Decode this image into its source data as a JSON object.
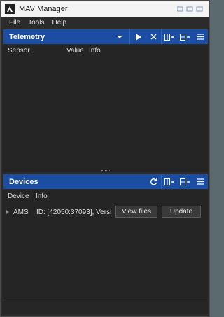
{
  "window": {
    "title": "MAV Manager"
  },
  "menu": {
    "items": [
      "File",
      "Tools",
      "Help"
    ]
  },
  "telemetry": {
    "title": "Telemetry",
    "columns": [
      "Sensor",
      "Value",
      "Info"
    ]
  },
  "devices": {
    "title": "Devices",
    "columns": [
      "Device",
      "Info"
    ],
    "rows": [
      {
        "device": "AMS",
        "info": "ID: [42050:37093], Versi",
        "view_label": "View files",
        "update_label": "Update"
      }
    ]
  },
  "icons": {
    "play": "play-icon",
    "close": "close-icon",
    "add_column": "add-column-icon",
    "add_row": "add-row-icon",
    "menu": "hamburger-menu-icon",
    "refresh": "refresh-icon"
  },
  "colors": {
    "header_blue": "#1b4da2",
    "panel_bg": "#252525",
    "window_bg": "#2b2b2b"
  }
}
